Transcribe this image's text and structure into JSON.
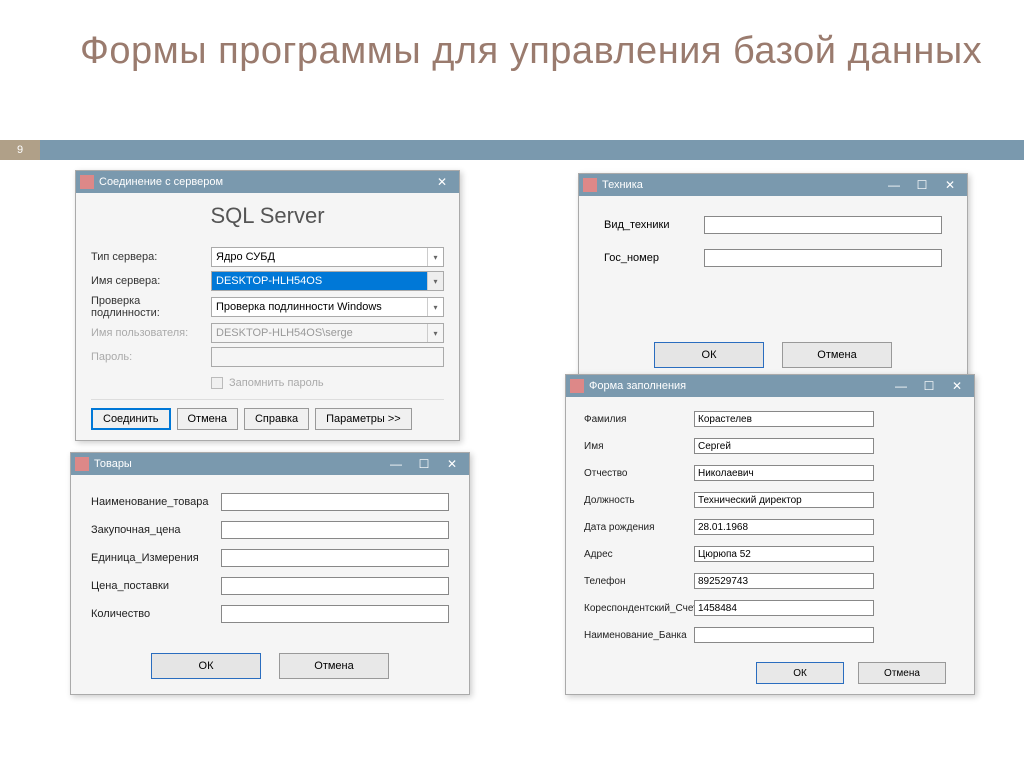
{
  "slide": {
    "title": "Формы программы для управления базой данных",
    "number": "9"
  },
  "sql": {
    "window_title": "Соединение с сервером",
    "heading": "SQL Server",
    "rows": {
      "server_type_label": "Тип сервера:",
      "server_type_value": "Ядро СУБД",
      "server_name_label": "Имя сервера:",
      "server_name_value": "DESKTOP-HLH54OS",
      "auth_label": "Проверка подлинности:",
      "auth_value": "Проверка подлинности Windows",
      "user_label": "Имя пользователя:",
      "user_value": "DESKTOP-HLH54OS\\serge",
      "pass_label": "Пароль:",
      "remember_label": "Запомнить пароль"
    },
    "buttons": {
      "connect": "Соединить",
      "cancel": "Отмена",
      "help": "Справка",
      "params": "Параметры >>"
    }
  },
  "tech": {
    "window_title": "Техника",
    "type_label": "Вид_техники",
    "number_label": "Гос_номер",
    "ok": "ОК",
    "cancel": "Отмена"
  },
  "goods": {
    "window_title": "Товары",
    "name_label": "Наименование_товара",
    "buy_price_label": "Закупочная_цена",
    "unit_label": "Единица_Измерения",
    "supply_price_label": "Цена_поставки",
    "qty_label": "Количество",
    "ok": "ОК",
    "cancel": "Отмена"
  },
  "fill": {
    "window_title": "Форма заполнения",
    "fields": {
      "surname_label": "Фамилия",
      "surname_value": "Корастелев",
      "name_label": "Имя",
      "name_value": "Сергей",
      "patronymic_label": "Отчество",
      "patronymic_value": "Николаевич",
      "position_label": "Должность",
      "position_value": "Технический директор",
      "dob_label": "Дата рождения",
      "dob_value": "28.01.1968",
      "address_label": "Адрес",
      "address_value": "Цюрюпа 52",
      "phone_label": "Телефон",
      "phone_value": "892529743",
      "account_label": "Кореспондентский_Счет",
      "account_value": "1458484",
      "bank_label": "Наименование_Банка",
      "bank_value": ""
    },
    "ok": "ОК",
    "cancel": "Отмена"
  }
}
